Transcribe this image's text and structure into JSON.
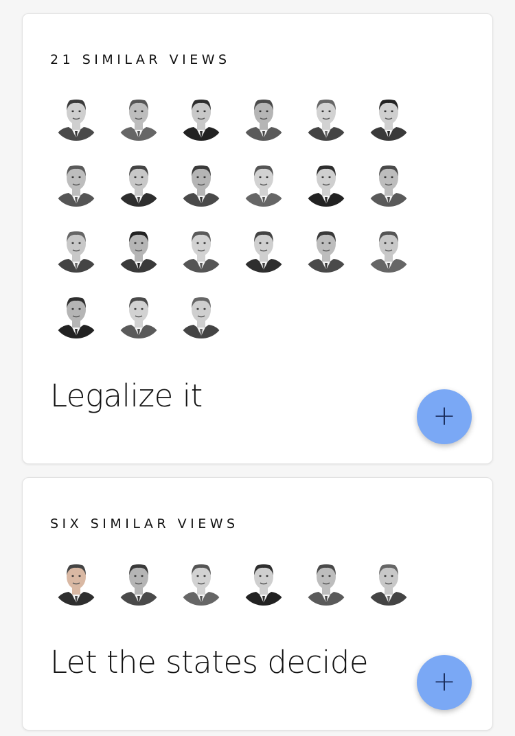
{
  "colors": {
    "fab_background": "#7aa8f5",
    "fab_icon": "#1a2d5c",
    "card_background": "#ffffff",
    "page_background": "#f6f6f6"
  },
  "cards": [
    {
      "header": "21 SIMILAR VIEWS",
      "title": "Legalize it",
      "add_button_icon": "+",
      "add_button_icon_name": "plus-icon",
      "face_count": 21
    },
    {
      "header": "SIX SIMILAR VIEWS",
      "title": "Let the states decide",
      "add_button_icon": "+",
      "add_button_icon_name": "plus-icon",
      "face_count": 6
    }
  ]
}
